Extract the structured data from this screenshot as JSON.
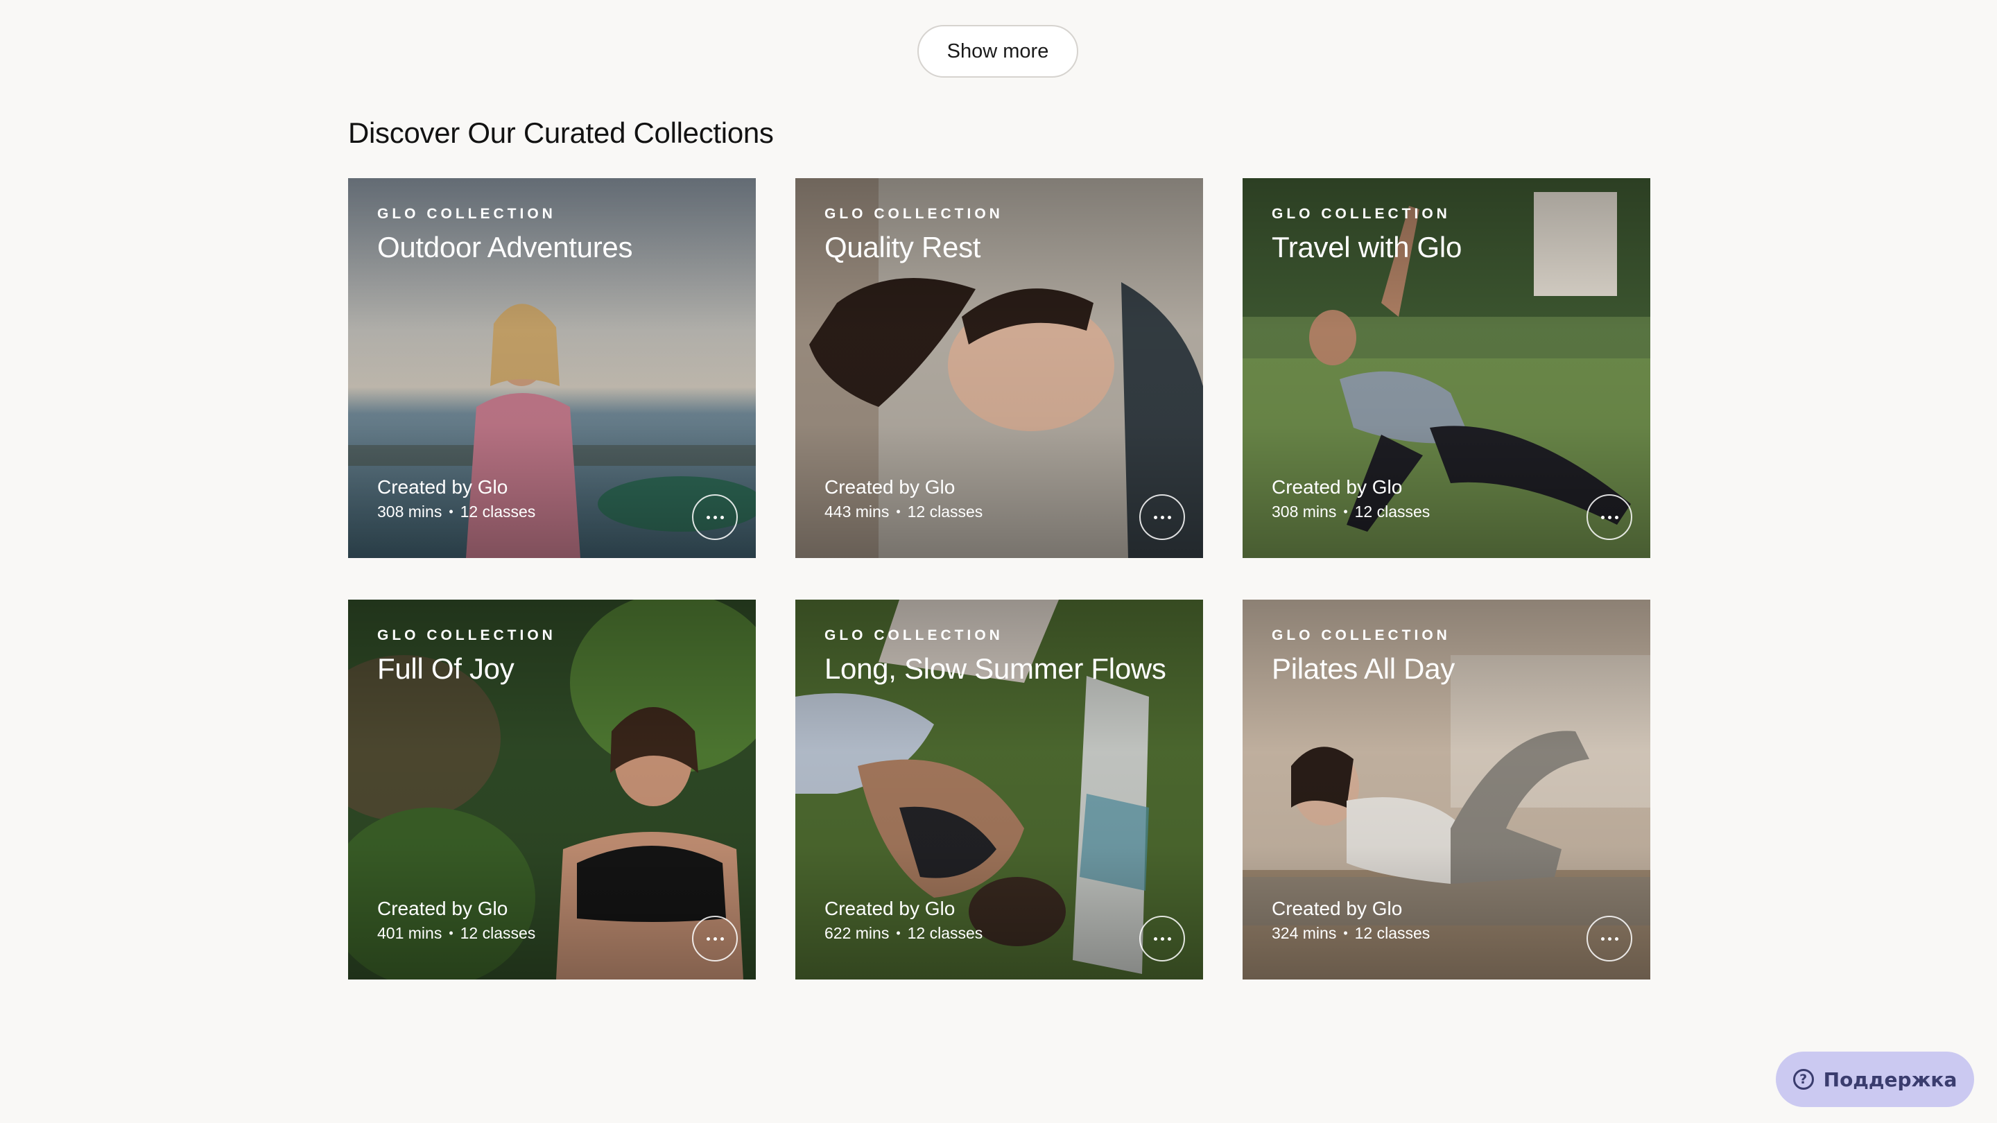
{
  "show_more": {
    "label": "Show more"
  },
  "section": {
    "title": "Discover Our Curated Collections"
  },
  "collections": [
    {
      "eyebrow": "GLO COLLECTION",
      "title": "Outdoor Adventures",
      "creator": "Created by Glo",
      "duration": "308 mins",
      "classes": "12 classes"
    },
    {
      "eyebrow": "GLO COLLECTION",
      "title": "Quality Rest",
      "creator": "Created by Glo",
      "duration": "443 mins",
      "classes": "12 classes"
    },
    {
      "eyebrow": "GLO COLLECTION",
      "title": "Travel with Glo",
      "creator": "Created by Glo",
      "duration": "308 mins",
      "classes": "12 classes"
    },
    {
      "eyebrow": "GLO COLLECTION",
      "title": "Full Of Joy",
      "creator": "Created by Glo",
      "duration": "401 mins",
      "classes": "12 classes"
    },
    {
      "eyebrow": "GLO COLLECTION",
      "title": "Long, Slow Summer Flows",
      "creator": "Created by Glo",
      "duration": "622 mins",
      "classes": "12 classes"
    },
    {
      "eyebrow": "GLO COLLECTION",
      "title": "Pilates All Day",
      "creator": "Created by Glo",
      "duration": "324 mins",
      "classes": "12 classes"
    }
  ],
  "meta_separator": "•",
  "support": {
    "label": "Поддержка",
    "icon": "question-circle-icon",
    "icon_glyph": "?"
  },
  "colors": {
    "background": "#f9f8f6",
    "support_bg": "#cbc9f1",
    "support_fg": "#3a3c6e"
  }
}
